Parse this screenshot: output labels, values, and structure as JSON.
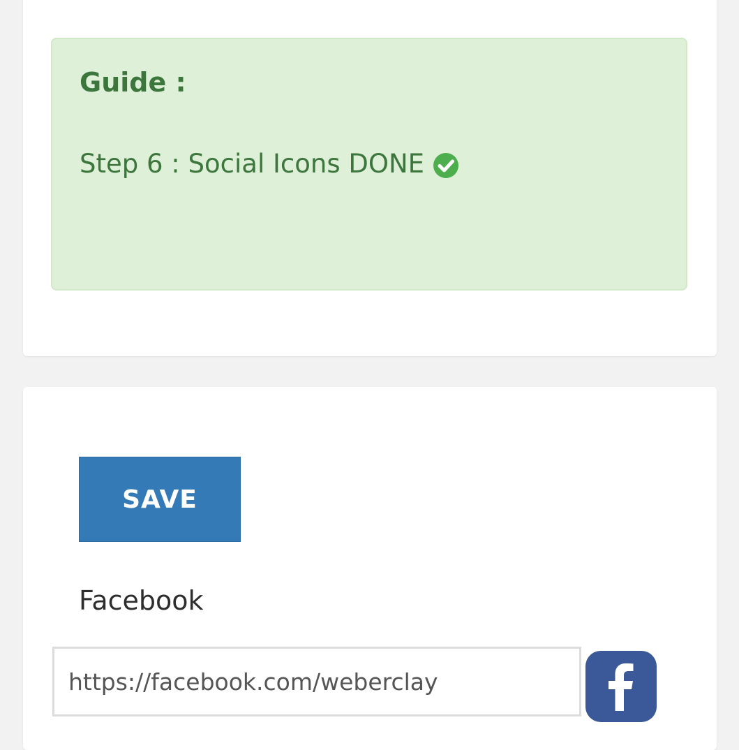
{
  "guide": {
    "title": "Guide :",
    "step_text": "Step 6 : Social Icons DONE",
    "status_icon": "check-circle-icon"
  },
  "form": {
    "save_label": "SAVE",
    "facebook": {
      "label": "Facebook",
      "value": "https://facebook.com/weberclay",
      "icon": "facebook-icon"
    }
  },
  "colors": {
    "page_background": "#f2f2f2",
    "guide_background": "#dff0d8",
    "guide_text": "#3c763d",
    "check_green": "#4cae4c",
    "save_button": "#337ab7",
    "facebook_blue": "#3b5998"
  }
}
